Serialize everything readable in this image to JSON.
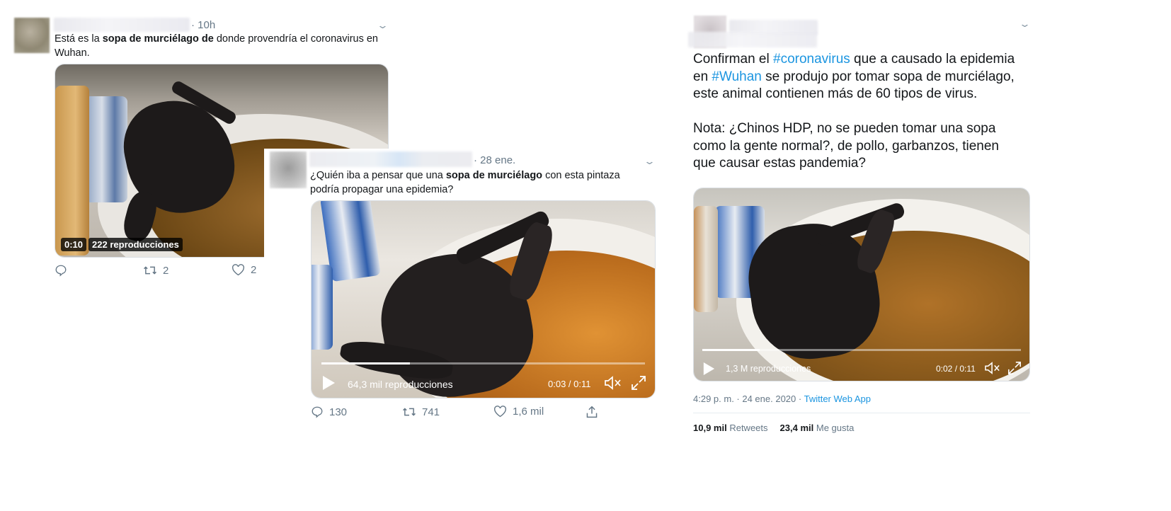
{
  "tweet1": {
    "time": "· 10h",
    "text_before": "Está es la ",
    "text_bold": "sopa de murciélago  de",
    "text_after": " donde provendría el coronavirus en Wuhan.",
    "video_duration": "0:10",
    "video_views": "222 reproducciones",
    "retweets": "2",
    "likes": "2"
  },
  "tweet2": {
    "time": "· 28 ene.",
    "text_before": "¿Quién iba a pensar que una ",
    "text_bold": "sopa de murciélago",
    "text_after": " con esta pintaza podría propagar una epidemia?",
    "video_views": "64,3 mil reproducciones",
    "video_time": "0:03 / 0:11",
    "progress": 0.27,
    "replies": "130",
    "retweets": "741",
    "likes": "1,6 mil"
  },
  "tweet3": {
    "line1_pre": "Confirman el ",
    "hashtag1": "#coronavirus",
    "line1_post": " que a causado la epidemia",
    "line2_pre": "en ",
    "hashtag2": "#Wuhan",
    "line2_post": " se produjo por tomar sopa de murciélago,",
    "line3": "este animal contienen más de 60 tipos de virus.",
    "note1": "Nota: ¿Chinos HDP, no se pueden tomar una sopa",
    "note2": "como la gente normal?, de pollo, garbanzos, tienen",
    "note3": "que causar estas pandemia?",
    "video_views": "1,3 M reproducciones",
    "video_time": "0:02 / 0:11",
    "progress": 0.18,
    "timestamp": "4:29 p. m. · 24 ene. 2020 · ",
    "source": "Twitter Web App",
    "retweets_count": "10,9 mil",
    "retweets_label": "Retweets",
    "likes_count": "23,4 mil",
    "likes_label": "Me gusta"
  },
  "colors": {
    "link": "#1b95e0",
    "meta": "#657786",
    "text": "#14171a"
  }
}
